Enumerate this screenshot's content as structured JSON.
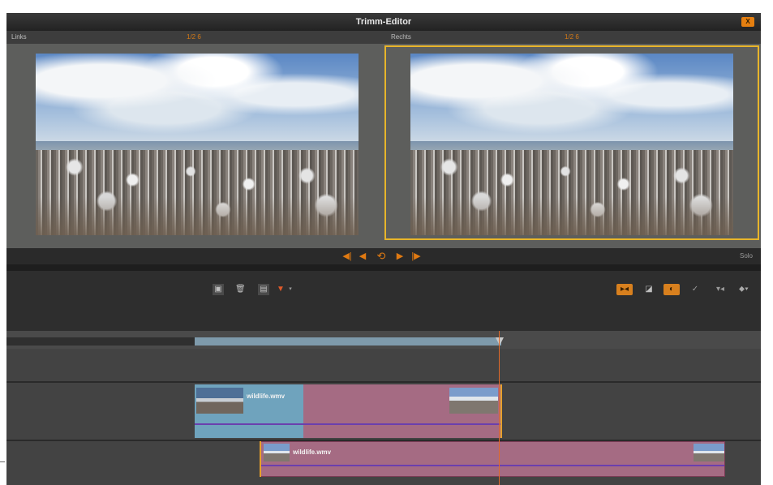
{
  "window": {
    "title": "Trimm-Editor",
    "close_label": "X"
  },
  "labels": {
    "left": "Links",
    "left_pos": "1/2 6",
    "right": "Rechts",
    "right_pos": "1/2 6"
  },
  "transport": {
    "buttons": [
      "◀|",
      "◀",
      "⟲",
      "▶",
      "|▶"
    ],
    "solo_label": "Solo"
  },
  "toolbar": {
    "left_icons": [
      "film-icon",
      "trash-icon",
      "clip-icon",
      "marker-icon",
      "dropdown-icon"
    ],
    "right_icons": [
      "trim-mode-icon",
      "ripple-icon",
      "rolling-icon",
      "slip-icon",
      "audio-icon",
      "dropdown-icon"
    ]
  },
  "clips": [
    {
      "name": "wildlife.wmv"
    },
    {
      "name": "wildlife.wmv"
    }
  ],
  "colors": {
    "accent": "#e07a12",
    "selection": "#e8b52a",
    "clip_pink": "#a56b83",
    "clip_blue": "#6fa3bd"
  }
}
